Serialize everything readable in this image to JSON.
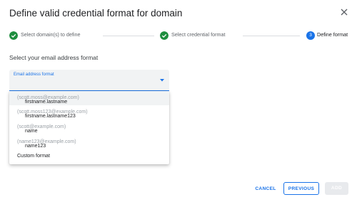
{
  "dialog": {
    "title": "Define valid credential format for domain"
  },
  "stepper": {
    "steps": [
      {
        "label": "Select domain(s) to define",
        "state": "done"
      },
      {
        "label": "Select credential format",
        "state": "done"
      },
      {
        "label": "Define format",
        "number": "3",
        "state": "active"
      }
    ],
    "colors": {
      "done": "#1e8e3e",
      "active": "#1a73e8"
    }
  },
  "section": {
    "heading": "Select your email address format"
  },
  "select": {
    "label": "Email address format",
    "icon": "arrow-drop-down-icon"
  },
  "menu": {
    "options": [
      {
        "name": "firstname.lastname",
        "hint": "(scott.moss@example.com)",
        "highlighted": true
      },
      {
        "name": "firstname.lastname123",
        "hint": "(scott.moss123@example.com)",
        "highlighted": false
      },
      {
        "name": "name",
        "hint": "(scott@example.com)",
        "highlighted": false
      },
      {
        "name": "name123",
        "hint": "(name123@example.com)",
        "highlighted": false
      },
      {
        "name": "Custom format",
        "hint": "",
        "highlighted": false
      }
    ]
  },
  "footer": {
    "cancel": "CANCEL",
    "previous": "PREVIOUS",
    "add": "ADD"
  }
}
